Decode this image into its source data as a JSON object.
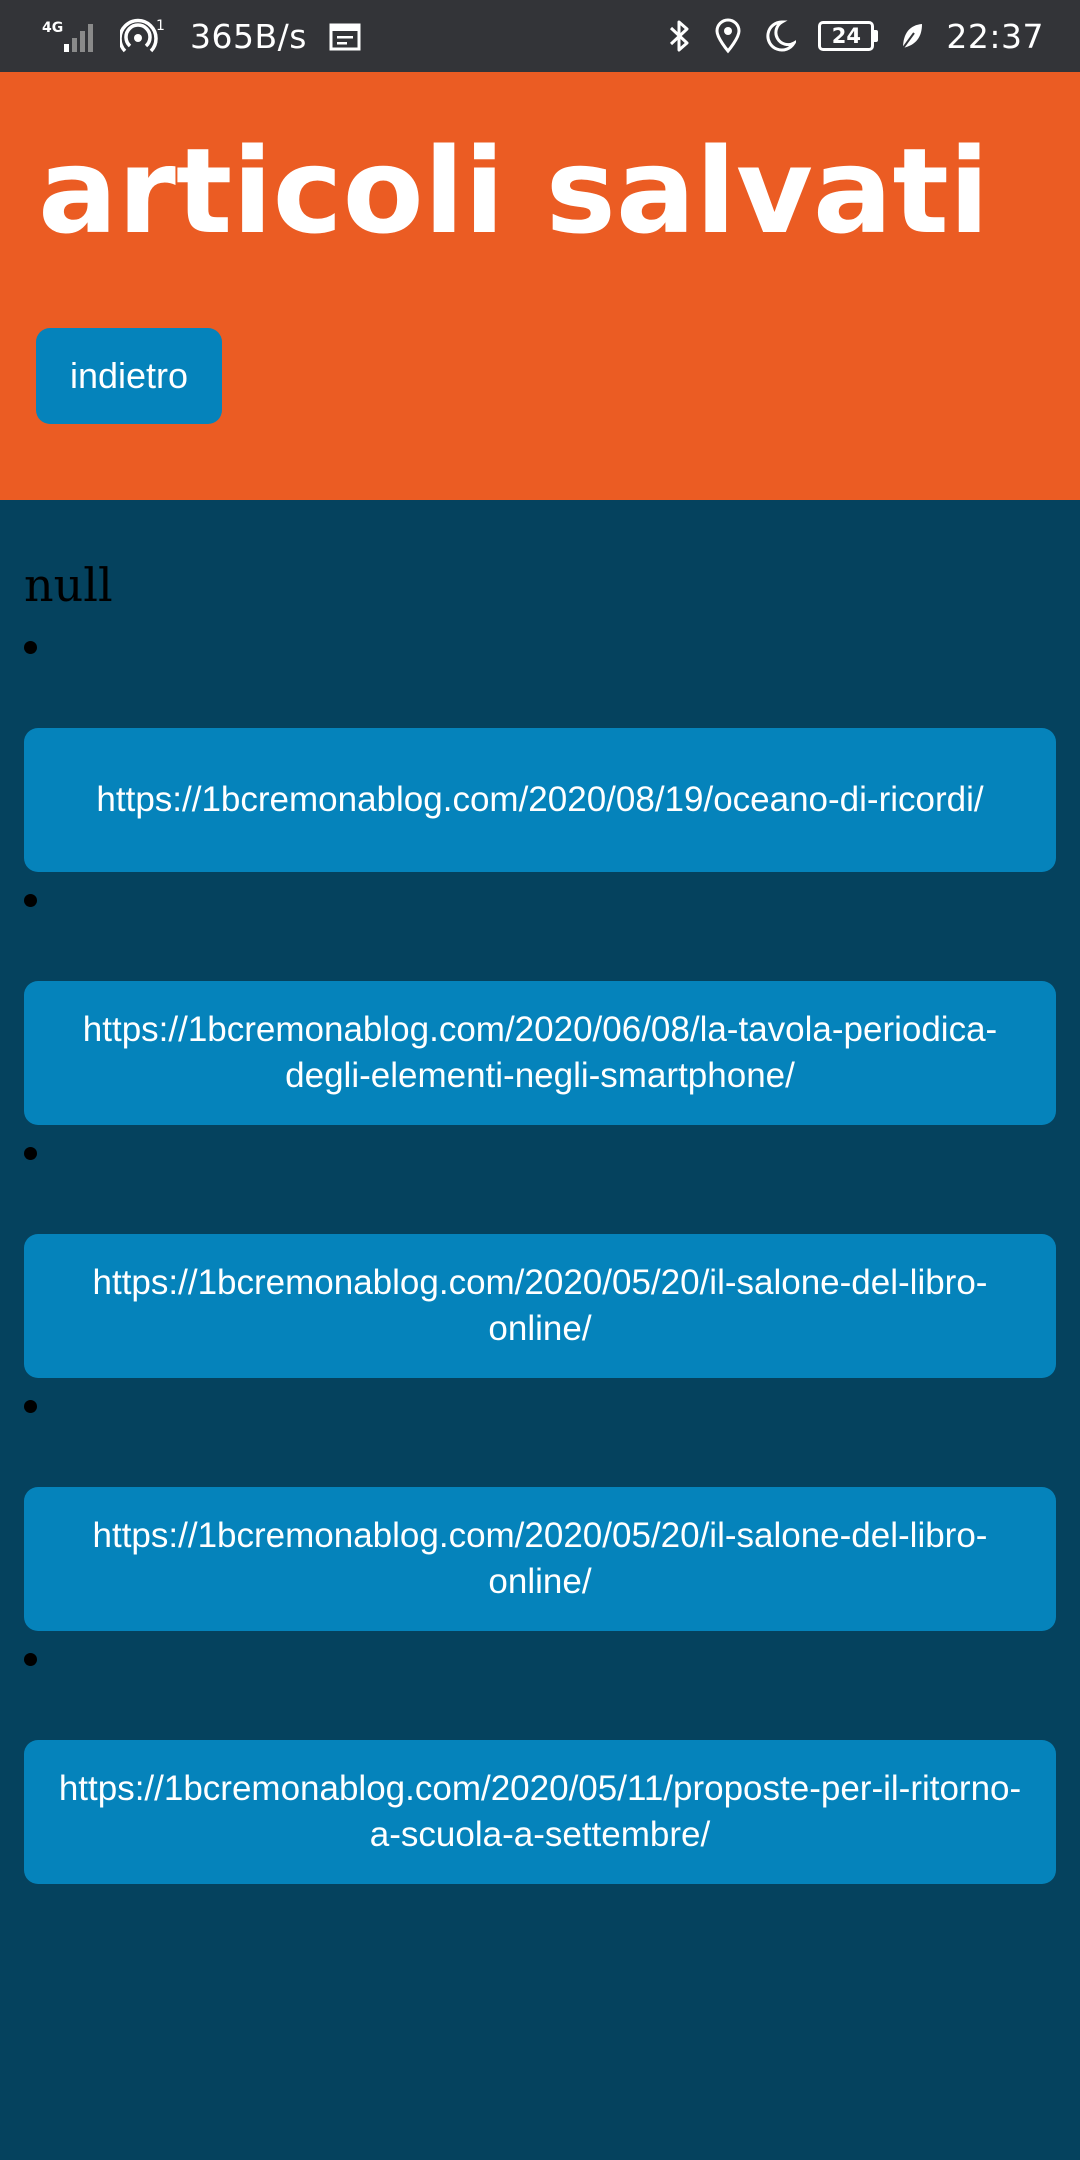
{
  "status_bar": {
    "network_type": "4G",
    "hotspot_count": "1",
    "speed": "365B/s",
    "battery": "24",
    "time": "22:37",
    "icons": [
      "signal-icon",
      "hotspot-icon",
      "calendar-icon",
      "bluetooth-icon",
      "location-icon",
      "moon-icon",
      "battery-icon",
      "leaf-icon"
    ]
  },
  "header": {
    "title": "articoli salvati",
    "back_label": "indietro"
  },
  "content": {
    "null_label": "null",
    "articles": [
      {
        "url": "https://1bcremonablog.com/2020/08/19/oceano-di-ricordi/"
      },
      {
        "url": "https://1bcremonablog.com/2020/06/08/la-tavola-periodica-degli-elementi-negli-smartphone/"
      },
      {
        "url": "https://1bcremonablog.com/2020/05/20/il-salone-del-libro-online/"
      },
      {
        "url": "https://1bcremonablog.com/2020/05/20/il-salone-del-libro-online/"
      },
      {
        "url": "https://1bcremonablog.com/2020/05/11/proposte-per-il-ritorno-a-scuola-a-settembre/"
      }
    ]
  },
  "colors": {
    "header": "#eb5c23",
    "background": "#05425e",
    "button": "#0583bb",
    "status_bar": "#333438"
  }
}
